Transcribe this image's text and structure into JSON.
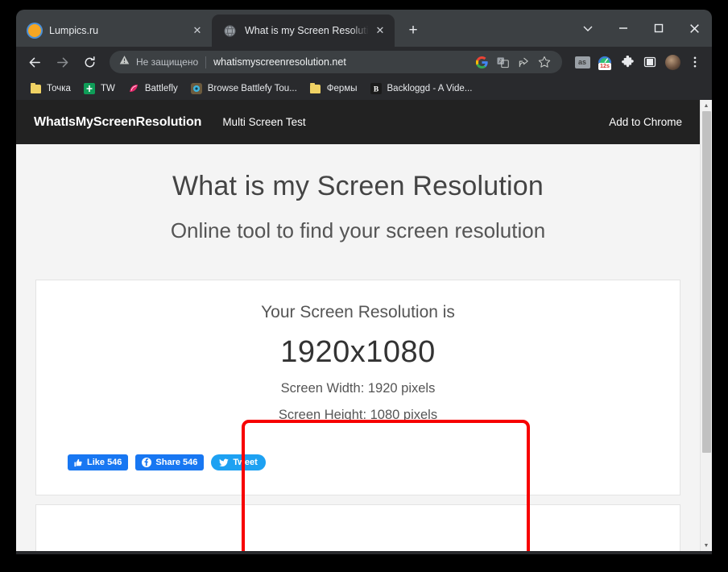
{
  "browser": {
    "tabs": [
      {
        "title": "Lumpics.ru",
        "favicon": "lumpics-favicon",
        "active": false,
        "close_label": "✕"
      },
      {
        "title": "What is my Screen Resolution: Fin",
        "favicon": "globe-icon",
        "active": true,
        "close_label": "✕"
      }
    ],
    "new_tab_label": "+",
    "window_controls": {
      "tab_search": "⌄",
      "minimize": "—",
      "maximize": "☐",
      "close": "✕"
    },
    "navigation": {
      "back": "←",
      "forward": "→",
      "reload": "↻"
    },
    "omnibox": {
      "security_label": "Не защищено",
      "url": "whatismyscreenresolution.net",
      "actions": [
        "google-icon",
        "translate-icon",
        "share-icon",
        "bookmark-star-icon"
      ]
    },
    "extensions": [
      {
        "name": "lastfm-extension-icon",
        "label": "as"
      },
      {
        "name": "speedometer-extension-icon",
        "badge": "12s"
      },
      {
        "name": "extensions-puzzle-icon"
      },
      {
        "name": "side-panel-icon"
      },
      {
        "name": "profile-avatar"
      },
      {
        "name": "chrome-menu-icon"
      }
    ],
    "bookmarks": [
      {
        "label": "Точка",
        "icon": "folder-icon"
      },
      {
        "label": "TW",
        "icon": "sheets-icon"
      },
      {
        "label": "Battlefly",
        "icon": "battlefly-icon"
      },
      {
        "label": "Browse Battlefy Tou...",
        "icon": "battlefy-icon"
      },
      {
        "label": "Фермы",
        "icon": "folder-icon"
      },
      {
        "label": "Backloggd - A Vide...",
        "icon": "backloggd-icon"
      }
    ]
  },
  "site": {
    "brand": "WhatIsMyScreenResolution",
    "nav_link": "Multi Screen Test",
    "add_to_chrome": "Add to Chrome",
    "heading": "What is my Screen Resolution",
    "subheading": "Online tool to find your screen resolution",
    "result": {
      "label": "Your Screen Resolution is",
      "value": "1920x1080",
      "width_text": "Screen Width: 1920 pixels",
      "height_text": "Screen Height: 1080 pixels"
    },
    "social": {
      "like_label": "Like 546",
      "share_label": "Share 546",
      "tweet_label": "Tweet"
    }
  },
  "colors": {
    "facebook_blue": "#1877f2",
    "twitter_blue": "#1da1f2",
    "annotation_red": "#f70000",
    "tabstrip": "#3c4043",
    "toolbar": "#292a2d",
    "site_nav": "#222222",
    "page_bg": "#f4f4f4"
  },
  "scrollbar": {
    "up_arrow": "▲",
    "down_arrow": "▼"
  }
}
